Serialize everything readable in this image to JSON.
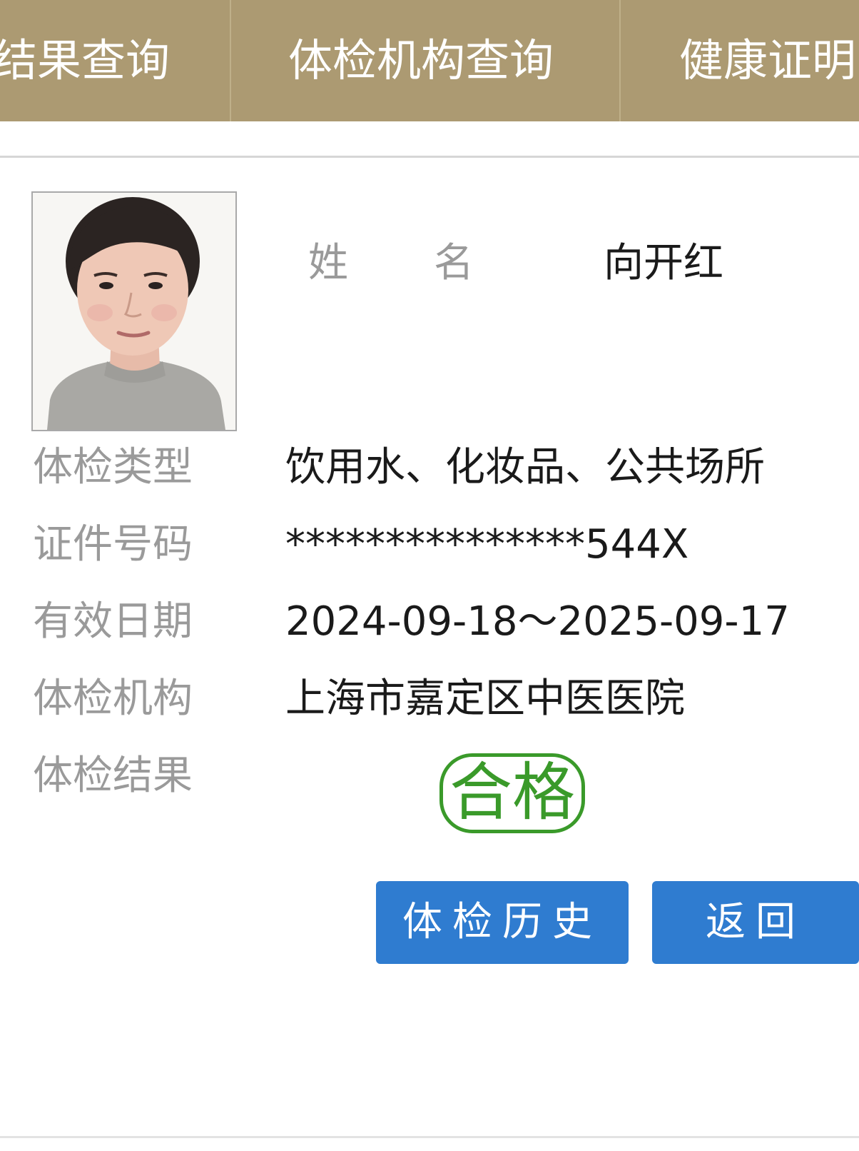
{
  "nav": {
    "tabs": [
      {
        "label": "结果查询"
      },
      {
        "label": "体检机构查询"
      },
      {
        "label": "健康证明"
      }
    ]
  },
  "profile": {
    "name_label_1": "姓",
    "name_label_2": "名",
    "name_value": "向开红"
  },
  "fields": [
    {
      "label": "体检类型",
      "value": "饮用水、化妆品、公共场所"
    },
    {
      "label": "证件号码",
      "value": "***************544X"
    },
    {
      "label": "有效日期",
      "value": "2024-09-18～2025-09-17"
    },
    {
      "label": "体检机构",
      "value": "上海市嘉定区中医医院"
    }
  ],
  "result": {
    "label": "体检结果",
    "value": "合格",
    "color": "#3a9a2a"
  },
  "buttons": {
    "history": "体检历史",
    "back": "返回"
  },
  "colors": {
    "nav_bg": "#ac9a72",
    "button_bg": "#2f7cd0"
  }
}
